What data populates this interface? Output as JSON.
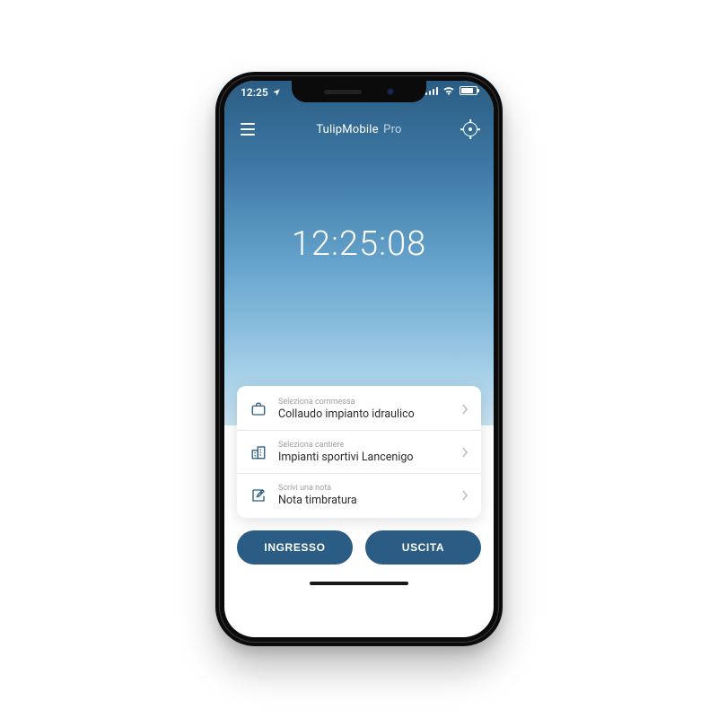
{
  "status": {
    "time": "12:25"
  },
  "header": {
    "title_main": "TulipMobile",
    "title_suffix": "Pro"
  },
  "clock": {
    "hh": "12",
    "mm": "25",
    "ss": "08"
  },
  "card": {
    "commessa": {
      "label": "Seleziona commessa",
      "value": "Collaudo impianto idraulico"
    },
    "cantiere": {
      "label": "Seleziona cantiere",
      "value": "Impianti sportivi Lancenigo"
    },
    "nota": {
      "label": "Scrivi una nota",
      "value": "Nota timbratura"
    }
  },
  "actions": {
    "ingresso": "INGRESSO",
    "uscita": "USCITA"
  },
  "colors": {
    "accent": "#2b5d84"
  }
}
